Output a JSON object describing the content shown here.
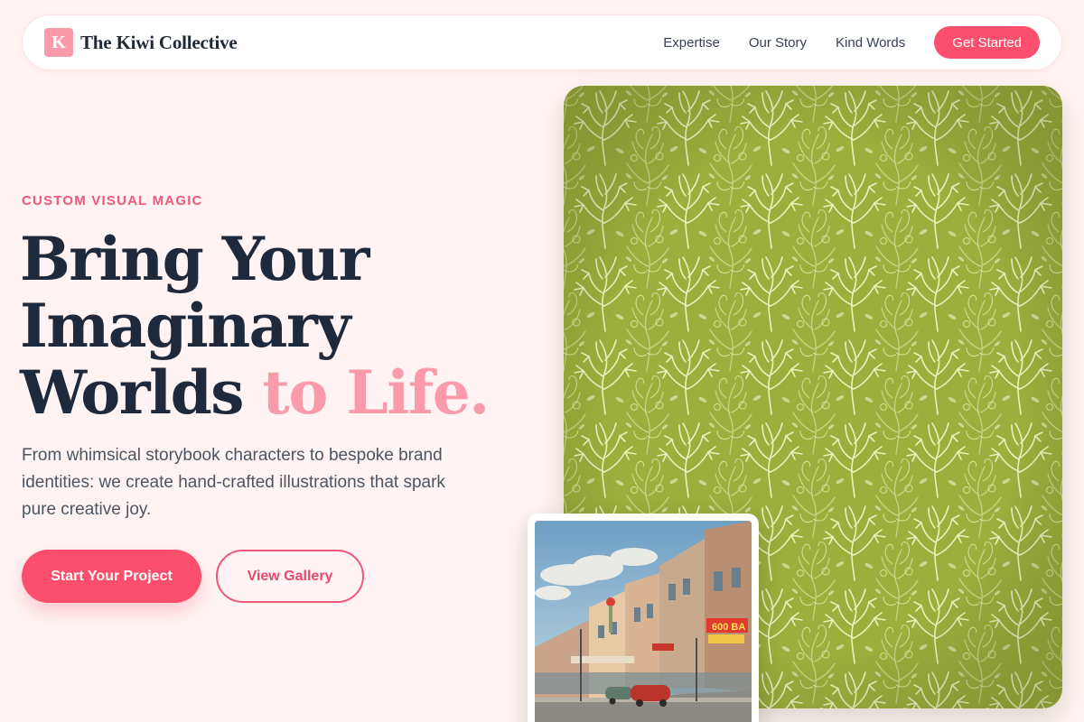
{
  "brand": {
    "logo_letter": "K",
    "name": "The Kiwi Collective"
  },
  "nav": {
    "links": [
      "Expertise",
      "Our Story",
      "Kind Words"
    ],
    "cta_label": "Get Started"
  },
  "hero": {
    "eyebrow": "CUSTOM VISUAL MAGIC",
    "headline_line1": "Bring Your",
    "headline_line2": "Imaginary",
    "headline_line3_main": "Worlds ",
    "headline_line3_accent": "to Life.",
    "subtext": "From whimsical storybook characters to bespoke brand identities: we create hand-crafted illustrations that spark pure creative joy.",
    "primary_button": "Start Your Project",
    "secondary_button": "View Gallery"
  },
  "postcard": {
    "sign_text": "600 BA"
  },
  "colors": {
    "accent": "#fb4f6d",
    "accent_soft": "#fb9aa8",
    "background": "#fff4f3",
    "heading": "#1e293b",
    "pattern_green": "#9aab3a"
  }
}
